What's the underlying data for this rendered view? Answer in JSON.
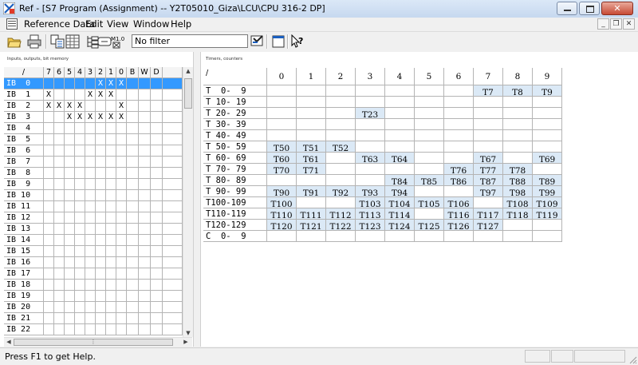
{
  "window": {
    "title": "Ref - [S7 Program (Assignment) -- Y2T05010_Giza\\LCU\\CPU 316-2 DP]"
  },
  "menu": [
    "Reference Data",
    "Edit",
    "View",
    "Window",
    "Help"
  ],
  "toolbar": {
    "filter_value": "No filter"
  },
  "left_panel": {
    "title": "Inputs, outputs, bit memory",
    "bit_labels": [
      "7",
      "6",
      "5",
      "4",
      "3",
      "2",
      "1",
      "0"
    ],
    "extra_labels": [
      "B",
      "W",
      "D"
    ],
    "rows": [
      {
        "addr": "IB  0",
        "bits": [
          "",
          "",
          "",
          "",
          "",
          "X",
          "X",
          "X"
        ],
        "selected": true
      },
      {
        "addr": "IB  1",
        "bits": [
          "X",
          "",
          "",
          "",
          "X",
          "X",
          "X",
          ""
        ]
      },
      {
        "addr": "IB  2",
        "bits": [
          "X",
          "X",
          "X",
          "X",
          "",
          "",
          "",
          "X"
        ]
      },
      {
        "addr": "IB  3",
        "bits": [
          "",
          "",
          "X",
          "X",
          "X",
          "X",
          "X",
          "X"
        ]
      },
      {
        "addr": "IB  4",
        "bits": [
          "",
          "",
          "",
          "",
          "",
          "",
          "",
          ""
        ]
      },
      {
        "addr": "IB  5",
        "bits": [
          "",
          "",
          "",
          "",
          "",
          "",
          "",
          ""
        ]
      },
      {
        "addr": "IB  6",
        "bits": [
          "",
          "",
          "",
          "",
          "",
          "",
          "",
          ""
        ]
      },
      {
        "addr": "IB  7",
        "bits": [
          "",
          "",
          "",
          "",
          "",
          "",
          "",
          ""
        ]
      },
      {
        "addr": "IB  8",
        "bits": [
          "",
          "",
          "",
          "",
          "",
          "",
          "",
          ""
        ]
      },
      {
        "addr": "IB  9",
        "bits": [
          "",
          "",
          "",
          "",
          "",
          "",
          "",
          ""
        ]
      },
      {
        "addr": "IB 10",
        "bits": [
          "",
          "",
          "",
          "",
          "",
          "",
          "",
          ""
        ]
      },
      {
        "addr": "IB 11",
        "bits": [
          "",
          "",
          "",
          "",
          "",
          "",
          "",
          ""
        ]
      },
      {
        "addr": "IB 12",
        "bits": [
          "",
          "",
          "",
          "",
          "",
          "",
          "",
          ""
        ]
      },
      {
        "addr": "IB 13",
        "bits": [
          "",
          "",
          "",
          "",
          "",
          "",
          "",
          ""
        ]
      },
      {
        "addr": "IB 14",
        "bits": [
          "",
          "",
          "",
          "",
          "",
          "",
          "",
          ""
        ]
      },
      {
        "addr": "IB 15",
        "bits": [
          "",
          "",
          "",
          "",
          "",
          "",
          "",
          ""
        ]
      },
      {
        "addr": "IB 16",
        "bits": [
          "",
          "",
          "",
          "",
          "",
          "",
          "",
          ""
        ]
      },
      {
        "addr": "IB 17",
        "bits": [
          "",
          "",
          "",
          "",
          "",
          "",
          "",
          ""
        ]
      },
      {
        "addr": "IB 18",
        "bits": [
          "",
          "",
          "",
          "",
          "",
          "",
          "",
          ""
        ]
      },
      {
        "addr": "IB 19",
        "bits": [
          "",
          "",
          "",
          "",
          "",
          "",
          "",
          ""
        ]
      },
      {
        "addr": "IB 20",
        "bits": [
          "",
          "",
          "",
          "",
          "",
          "",
          "",
          ""
        ]
      },
      {
        "addr": "IB 21",
        "bits": [
          "",
          "",
          "",
          "",
          "",
          "",
          "",
          ""
        ]
      },
      {
        "addr": "IB 22",
        "bits": [
          "",
          "",
          "",
          "",
          "",
          "",
          "",
          ""
        ]
      }
    ]
  },
  "right_panel": {
    "title": "Timers, counters",
    "columns": [
      "0",
      "1",
      "2",
      "3",
      "4",
      "5",
      "6",
      "7",
      "8",
      "9"
    ],
    "rows": [
      {
        "addr": "T  0-  9",
        "cells": [
          "",
          "",
          "",
          "",
          "",
          "",
          "",
          "T7",
          "T8",
          "T9"
        ]
      },
      {
        "addr": "T 10- 19",
        "cells": [
          "",
          "",
          "",
          "",
          "",
          "",
          "",
          "",
          "",
          ""
        ]
      },
      {
        "addr": "T 20- 29",
        "cells": [
          "",
          "",
          "",
          "T23",
          "",
          "",
          "",
          "",
          "",
          ""
        ]
      },
      {
        "addr": "T 30- 39",
        "cells": [
          "",
          "",
          "",
          "",
          "",
          "",
          "",
          "",
          "",
          ""
        ]
      },
      {
        "addr": "T 40- 49",
        "cells": [
          "",
          "",
          "",
          "",
          "",
          "",
          "",
          "",
          "",
          ""
        ]
      },
      {
        "addr": "T 50- 59",
        "cells": [
          "T50",
          "T51",
          "T52",
          "",
          "",
          "",
          "",
          "",
          "",
          ""
        ]
      },
      {
        "addr": "T 60- 69",
        "cells": [
          "T60",
          "T61",
          "",
          "T63",
          "T64",
          "",
          "",
          "T67",
          "",
          "T69"
        ]
      },
      {
        "addr": "T 70- 79",
        "cells": [
          "T70",
          "T71",
          "",
          "",
          "",
          "",
          "T76",
          "T77",
          "T78",
          ""
        ]
      },
      {
        "addr": "T 80- 89",
        "cells": [
          "",
          "",
          "",
          "",
          "T84",
          "T85",
          "T86",
          "T87",
          "T88",
          "T89"
        ]
      },
      {
        "addr": "T 90- 99",
        "cells": [
          "T90",
          "T91",
          "T92",
          "T93",
          "T94",
          "",
          "",
          "T97",
          "T98",
          "T99"
        ]
      },
      {
        "addr": "T100-109",
        "cells": [
          "T100",
          "",
          "",
          "T103",
          "T104",
          "T105",
          "T106",
          "",
          "T108",
          "T109"
        ]
      },
      {
        "addr": "T110-119",
        "cells": [
          "T110",
          "T111",
          "T112",
          "T113",
          "T114",
          "",
          "T116",
          "T117",
          "T118",
          "T119"
        ]
      },
      {
        "addr": "T120-129",
        "cells": [
          "T120",
          "T121",
          "T122",
          "T123",
          "T124",
          "T125",
          "T126",
          "T127",
          "",
          ""
        ]
      },
      {
        "addr": "C  0-  9",
        "cells": [
          "",
          "",
          "",
          "",
          "",
          "",
          "",
          "",
          "",
          ""
        ]
      }
    ]
  },
  "status": {
    "message": "Press F1 to get Help."
  }
}
